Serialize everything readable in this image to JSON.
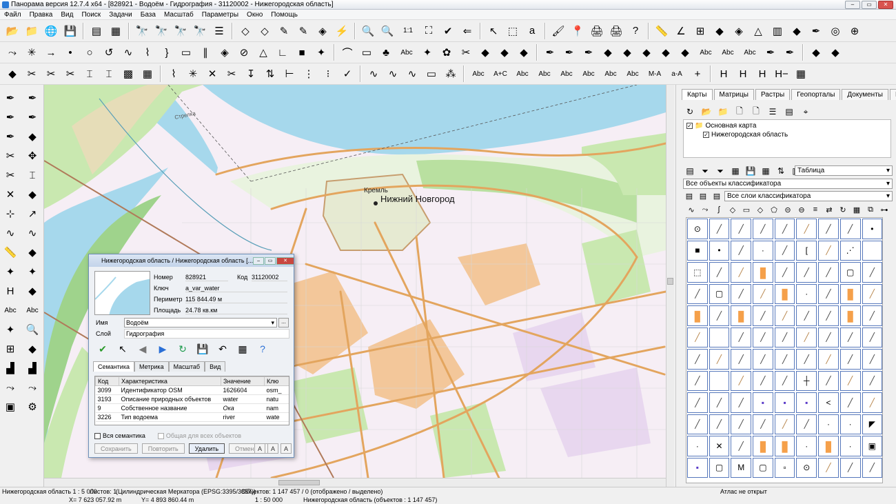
{
  "window": {
    "title": "Панорама версия 12.7.4 x64 - [828921 - Водоём - Гидрография - 31120002 - Нижегородская область]",
    "ghost_title": "Панорама Версия 12.7 x64 - Нижегородская область"
  },
  "menu": [
    "Файл",
    "Правка",
    "Вид",
    "Поиск",
    "Задачи",
    "База",
    "Масштаб",
    "Параметры",
    "Окно",
    "Помощь"
  ],
  "toolbar_rows": {
    "row1": [
      [
        "open-folder-icon",
        "📂"
      ],
      [
        "open-add-icon",
        "📁"
      ],
      [
        "globe-add-icon",
        "🌐"
      ],
      [
        "save-icon",
        "💾"
      ],
      "|",
      [
        "layers-icon",
        "▤"
      ],
      [
        "layers-settings-icon",
        "▦"
      ],
      "|",
      [
        "binoculars-icon",
        "🔭"
      ],
      [
        "binoculars-a-icon",
        "🔭"
      ],
      [
        "binoculars-next-icon",
        "🔭"
      ],
      [
        "binoculars-gray-icon",
        "🔭"
      ],
      [
        "list-icon",
        "☰"
      ],
      "|",
      [
        "eraser-icon",
        "◇"
      ],
      [
        "eraser-a-icon",
        "◇"
      ],
      [
        "pencil-add-icon",
        "✎"
      ],
      [
        "pencil-remove-icon",
        "✎"
      ],
      [
        "cube-icon",
        "◈"
      ],
      [
        "lightning-icon",
        "⚡"
      ],
      "|",
      [
        "zoom-out-icon",
        "🔍"
      ],
      [
        "zoom-in-icon",
        "🔍"
      ],
      [
        "zoom-one-to-one-icon",
        "1:1"
      ],
      [
        "fit-window-icon",
        "⛶"
      ],
      [
        "check-icon",
        "✔"
      ],
      [
        "back-arrow-icon",
        "⇐"
      ],
      "|",
      [
        "select-arrow-icon",
        "↖"
      ],
      [
        "select-frame-icon",
        "⬚"
      ],
      [
        "select-text-icon",
        "a"
      ],
      "|",
      [
        "brush-icon",
        "🖌"
      ],
      [
        "pin-icon",
        "📍"
      ],
      [
        "printer-icon",
        "🖨"
      ],
      [
        "printer-settings-icon",
        "🖨"
      ],
      [
        "help-cursor-icon",
        "?"
      ],
      "|",
      [
        "ruler-icon",
        "📏"
      ],
      [
        "angle-icon",
        "∠"
      ],
      [
        "grid-icon",
        "⊞"
      ],
      [
        "rhombus-icon",
        "◆"
      ],
      [
        "rhombus-grid-icon",
        "◈"
      ],
      [
        "triangle-icon",
        "△"
      ],
      [
        "barcode-icon",
        "▥"
      ],
      [
        "layers-blue-icon",
        "◆"
      ],
      [
        "pen-icon",
        "✒"
      ],
      [
        "eye-icon",
        "◎"
      ],
      [
        "compass-icon",
        "⊕"
      ]
    ],
    "row2": [
      [
        "line-split-icon",
        "⤳"
      ],
      [
        "star-split-icon",
        "✳"
      ],
      [
        "node-right-icon",
        "→"
      ],
      [
        "point-icon",
        "•"
      ],
      [
        "circle-icon",
        "○"
      ],
      [
        "loop-icon",
        "↺"
      ],
      [
        "curve-icon",
        "∿"
      ],
      [
        "vertex-icon",
        "⌇"
      ],
      [
        "brace-icon",
        "}"
      ],
      [
        "rectangle-icon",
        "▭"
      ],
      [
        "parallel-icon",
        "∥"
      ],
      [
        "tag-icon",
        "◈"
      ],
      [
        "ellipse-icon",
        "⊘"
      ],
      [
        "triangle-edit-icon",
        "△"
      ],
      [
        "angle-edit-icon",
        "∟"
      ],
      [
        "area-green-icon",
        "■"
      ],
      [
        "star-green-icon",
        "✦"
      ],
      "|",
      [
        "polyline-icon",
        "⌒"
      ],
      [
        "frame-green-icon",
        "▭"
      ],
      [
        "tree-icon",
        "♣"
      ],
      [
        "text-abc-icon",
        "Abc"
      ],
      [
        "torch-icon",
        "✦"
      ],
      [
        "plant-icon",
        "✿"
      ],
      [
        "scissors-red-icon",
        "✂"
      ],
      [
        "layers-green-icon",
        "◆"
      ],
      [
        "layers-red-icon",
        "◆"
      ],
      [
        "layers-brown-icon",
        "◆"
      ],
      "|",
      [
        "pen-a-icon",
        "✒"
      ],
      [
        "pen-b-icon",
        "✒"
      ],
      [
        "pen-c-icon",
        "✒"
      ],
      [
        "diamond-green-icon",
        "◆"
      ],
      [
        "diamond-multi-icon",
        "◆"
      ],
      [
        "diamond-x-icon",
        "◆"
      ],
      [
        "diamond-b-icon",
        "◆"
      ],
      [
        "diamond-c-icon",
        "◆"
      ],
      [
        "text-strike-icon",
        "Abc"
      ],
      [
        "text-wave-icon",
        "Abc"
      ],
      [
        "text-wave2-icon",
        "Abc"
      ],
      [
        "pen-d-icon",
        "✒"
      ],
      [
        "pen-e-icon",
        "✒"
      ],
      "|",
      [
        "diamond-red-icon",
        "◆"
      ],
      [
        "diamond-delete-icon",
        "◆"
      ]
    ],
    "row3": [
      [
        "diamond-move-icon",
        "◆"
      ],
      [
        "scissors-a-icon",
        "✂"
      ],
      [
        "scissors-b-icon",
        "✂"
      ],
      [
        "scissors-c-icon",
        "✂"
      ],
      [
        "node-bars-icon",
        "⌶"
      ],
      [
        "node-bars2-icon",
        "⌶"
      ],
      [
        "map-thumb-icon",
        "▩"
      ],
      [
        "grid-green-icon",
        "▦"
      ],
      "|",
      [
        "vertex-add-icon",
        "⌇"
      ],
      [
        "vertex-star-icon",
        "✳"
      ],
      [
        "vertex-x-icon",
        "✕"
      ],
      [
        "vertex-split-icon",
        "✂"
      ],
      [
        "vertex-arrow-icon",
        "↧"
      ],
      [
        "vertex-arrows-icon",
        "⇅"
      ],
      [
        "vertex-snap-icon",
        "⊢"
      ],
      [
        "vertex-multi-icon",
        "⋮"
      ],
      [
        "vertex-dots-icon",
        "⁝"
      ],
      [
        "vertex-green-icon",
        "✓"
      ],
      "|",
      [
        "spline-icon",
        "∿"
      ],
      [
        "spline2-icon",
        "∿"
      ],
      [
        "spline3-icon",
        "∿"
      ],
      [
        "monitor-icon",
        "▭"
      ],
      [
        "molecule-icon",
        "⁂"
      ],
      "|",
      [
        "label-abc-icon",
        "Abc"
      ],
      [
        "label-ac-icon",
        "A+C"
      ],
      [
        "label-strike-icon",
        "Abc"
      ],
      [
        "label-wave-icon",
        "Abc"
      ],
      [
        "label-wave2-icon",
        "Abc"
      ],
      [
        "label-box-icon",
        "Abc"
      ],
      [
        "text-red-icon",
        "Abc"
      ],
      [
        "text-gray-icon",
        "Abc"
      ],
      [
        "text-m-icon",
        "M-A"
      ],
      [
        "text-a-icon",
        "a-A"
      ],
      [
        "text-plus-icon",
        "+"
      ],
      "|",
      [
        "height-icon",
        "H"
      ],
      [
        "height-add-icon",
        "H"
      ],
      [
        "height-sub-icon",
        "H"
      ],
      [
        "height-minus-icon",
        "H−"
      ],
      [
        "height-grid-icon",
        "▦"
      ]
    ]
  },
  "left_tools": [
    [
      "pen-blue-icon",
      "✒"
    ],
    [
      "pen-edit-icon",
      "✒"
    ],
    [
      "pen-line-icon",
      "✒"
    ],
    [
      "pen-node-icon",
      "✒"
    ],
    [
      "pen-help-icon",
      "✒"
    ],
    [
      "layers-move-icon",
      "◆"
    ],
    [
      "scissors-rotate-icon",
      "✂"
    ],
    [
      "move-cross-icon",
      "✥"
    ],
    [
      "scissors-link-icon",
      "✂"
    ],
    [
      "node-edit-icon",
      "⌶"
    ],
    [
      "delete-red-icon",
      "✕"
    ],
    [
      "delete-layer-icon",
      "◆"
    ],
    [
      "node-split-icon",
      "⊹"
    ],
    [
      "node-arrow-icon",
      "↗"
    ],
    [
      "line-wave-icon",
      "∿"
    ],
    [
      "line-wave2-icon",
      "∿"
    ],
    [
      "ruler-yellow-icon",
      "📏"
    ],
    [
      "ruler-layer-icon",
      "◆"
    ],
    [
      "torch-a-icon",
      "✦"
    ],
    [
      "torch-b-icon",
      "✦"
    ],
    [
      "height-h-icon",
      "H"
    ],
    [
      "layer-copy-icon",
      "◆"
    ],
    [
      "text-abc-left-icon",
      "Abc"
    ],
    [
      "text-abc-right-icon",
      "Abc"
    ],
    [
      "torch-c-icon",
      "✦"
    ],
    [
      "zoom-object-icon",
      "🔍"
    ],
    [
      "tree-struct-icon",
      "⊞"
    ],
    [
      "diamond-select-icon",
      "◆"
    ],
    [
      "stairs-icon",
      "▟"
    ],
    [
      "stairs2-icon",
      "▟"
    ],
    [
      "wave-arrow-icon",
      "⤳"
    ],
    [
      "wave-arrow2-icon",
      "⤳"
    ],
    [
      "photo-icon",
      "▣"
    ],
    [
      "gear-icon",
      "⚙"
    ]
  ],
  "map": {
    "labels": {
      "city": "Нижний Новгород",
      "kremlin": "Кремль",
      "strelka": "Стрелка"
    },
    "colors": {
      "water": "#a6d8ec",
      "land": "#f6eef5",
      "forest": "#c9e8b0",
      "road": "#e3a55e",
      "block_orange": "#f3c79a"
    }
  },
  "right_panel": {
    "tabs": [
      "Карты",
      "Матрицы",
      "Растры",
      "Геопорталы",
      "Документы",
      "Модели"
    ],
    "active_tab": "Карты",
    "tree": {
      "root": "Основная карта",
      "child": "Нижегородская область"
    },
    "view_select": "Таблица",
    "filter_objects": "Все объекты классификатора",
    "filter_layers": "Все слои классификатора"
  },
  "dialog": {
    "title": "Нижегородская область / Нижегородская область [...",
    "fields": {
      "number_label": "Номер",
      "number": "828921",
      "code_label": "Код",
      "code": "31120002",
      "key_label": "Ключ",
      "key": "a_var_water",
      "perimeter_label": "Периметр",
      "perimeter": "115 844.49 м",
      "area_label": "Площадь",
      "area": "24.78 кв.км",
      "name_label": "Имя",
      "name": "Водоём",
      "layer_label": "Слой",
      "layer": "Гидрография"
    },
    "tabs": [
      "Семантика",
      "Метрика",
      "Масштаб",
      "Вид"
    ],
    "active_tab": "Семантика",
    "table": {
      "headers": [
        "Код",
        "Характеристика",
        "Значение",
        "Клю"
      ],
      "rows": [
        [
          "3099",
          "Идентификатор OSM",
          "1626604",
          "osm_"
        ],
        [
          "3193",
          "Описание природных объектов",
          "water",
          "natu"
        ],
        [
          "9",
          "Собственное название",
          "Ока",
          "nam"
        ],
        [
          "3226",
          "Тип водоема",
          "river",
          "wate"
        ]
      ]
    },
    "options": {
      "all_semantics": "Вся семантика",
      "common_for_all": "Общая для всех объектов"
    },
    "buttons": {
      "save": "Сохранить",
      "repeat": "Повторить",
      "delete": "Удалить",
      "cancel": "Отменить"
    },
    "font_buttons": [
      "A",
      "A",
      "A"
    ]
  },
  "status": {
    "region_scale": "Нижегородская область  1 : 5 000",
    "sheets": "Листов: 1",
    "projection": "(Цилиндрическая Меркатора (EPSG:3395/3857))",
    "objects": "Объектов: 1 147 457 / 0 (отображено / выделено)",
    "atlas": "Атлас не открыт",
    "x": "X= 7 623 057.92 m",
    "y": "Y= 4 893 860.44 m",
    "scale2": "1 : 50 000",
    "region_objects": "Нижегородская область   (объектов : 1 147 457)"
  }
}
